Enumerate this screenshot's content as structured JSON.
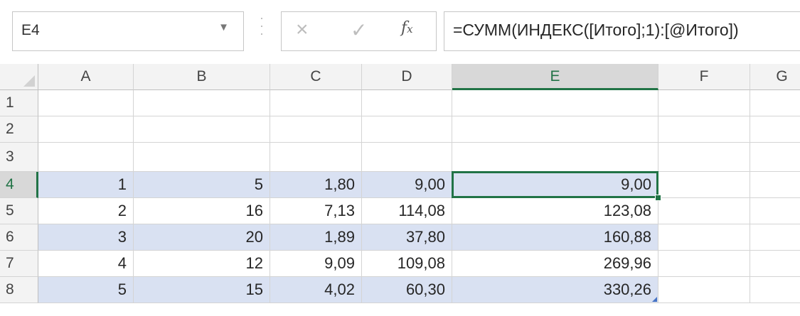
{
  "formula_bar": {
    "name_box": "E4",
    "name_box_arrow_icon": "dropdown-arrow",
    "cancel_icon": "×",
    "enter_icon": "✓",
    "fx_icon": "fx",
    "formula": "=СУММ(ИНДЕКС([Итого];1):[@Итого])"
  },
  "sheet": {
    "active_cell": "E4",
    "columns": [
      "A",
      "B",
      "C",
      "D",
      "E",
      "F",
      "G"
    ],
    "rows": [
      "1",
      "2",
      "3",
      "4",
      "5",
      "6",
      "7",
      "8"
    ],
    "cells": [
      [
        "",
        "",
        "",
        "",
        "",
        "",
        ""
      ],
      [
        "",
        "",
        "",
        "",
        "",
        "",
        ""
      ],
      [
        "",
        "",
        "",
        "",
        "",
        "",
        ""
      ],
      [
        "1",
        "5",
        "1,80",
        "9,00",
        "9,00",
        "",
        ""
      ],
      [
        "2",
        "16",
        "7,13",
        "114,08",
        "123,08",
        "",
        ""
      ],
      [
        "3",
        "20",
        "1,89",
        "37,80",
        "160,88",
        "",
        ""
      ],
      [
        "4",
        "12",
        "9,09",
        "109,08",
        "269,96",
        "",
        ""
      ],
      [
        "5",
        "15",
        "4,02",
        "60,30",
        "330,26",
        "",
        ""
      ]
    ],
    "colors": {
      "accent": "#217346",
      "table_band": "#d9e1f2",
      "table_corner": "#4472c4"
    }
  }
}
